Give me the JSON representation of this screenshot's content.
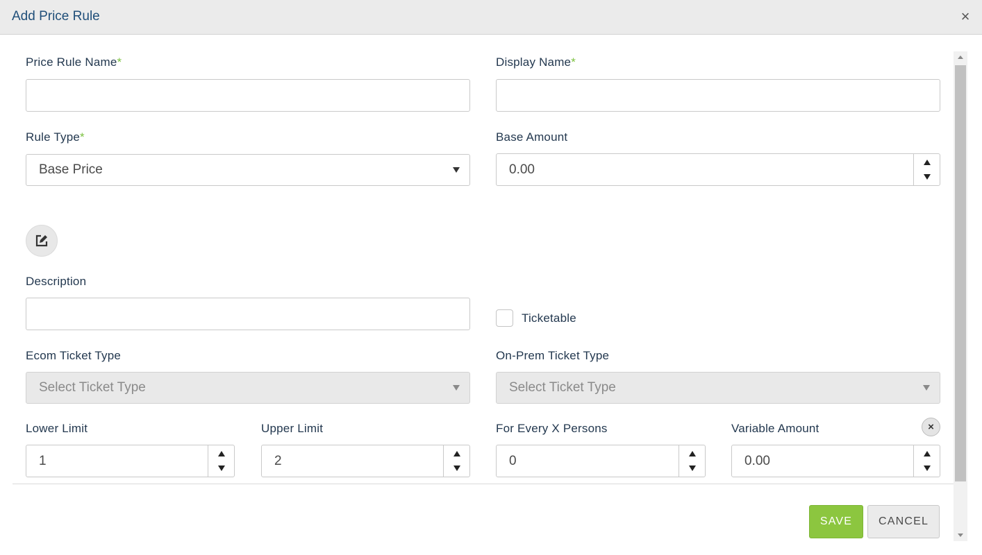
{
  "dialog": {
    "title": "Add Price Rule",
    "close_glyph": "×"
  },
  "fields": {
    "price_rule_name": {
      "label": "Price Rule Name",
      "required_mark": "*",
      "value": ""
    },
    "display_name": {
      "label": "Display Name",
      "required_mark": "*",
      "value": ""
    },
    "rule_type": {
      "label": "Rule Type",
      "required_mark": "*",
      "value": "Base Price"
    },
    "base_amount": {
      "label": "Base Amount",
      "value": "0.00"
    },
    "description": {
      "label": "Description",
      "value": ""
    },
    "ticketable": {
      "label": "Ticketable",
      "checked": false
    },
    "ecom_ticket_type": {
      "label": "Ecom Ticket Type",
      "placeholder": "Select Ticket Type"
    },
    "onprem_ticket_type": {
      "label": "On-Prem Ticket Type",
      "placeholder": "Select Ticket Type"
    }
  },
  "tier_row": {
    "lower_limit": {
      "label": "Lower Limit",
      "value": "1"
    },
    "upper_limit": {
      "label": "Upper Limit",
      "value": "2"
    },
    "for_every_x_persons": {
      "label": "For Every X Persons",
      "value": "0"
    },
    "variable_amount": {
      "label": "Variable Amount",
      "value": "0.00"
    },
    "remove_glyph": "×"
  },
  "buttons": {
    "save": "SAVE",
    "cancel": "CANCEL"
  },
  "colors": {
    "accent_green": "#8cc63f",
    "required_mark": "#7dc242",
    "title_blue": "#1f4e79"
  },
  "icons": {
    "edit": "edit-icon",
    "close": "close-icon",
    "remove": "remove-icon"
  }
}
